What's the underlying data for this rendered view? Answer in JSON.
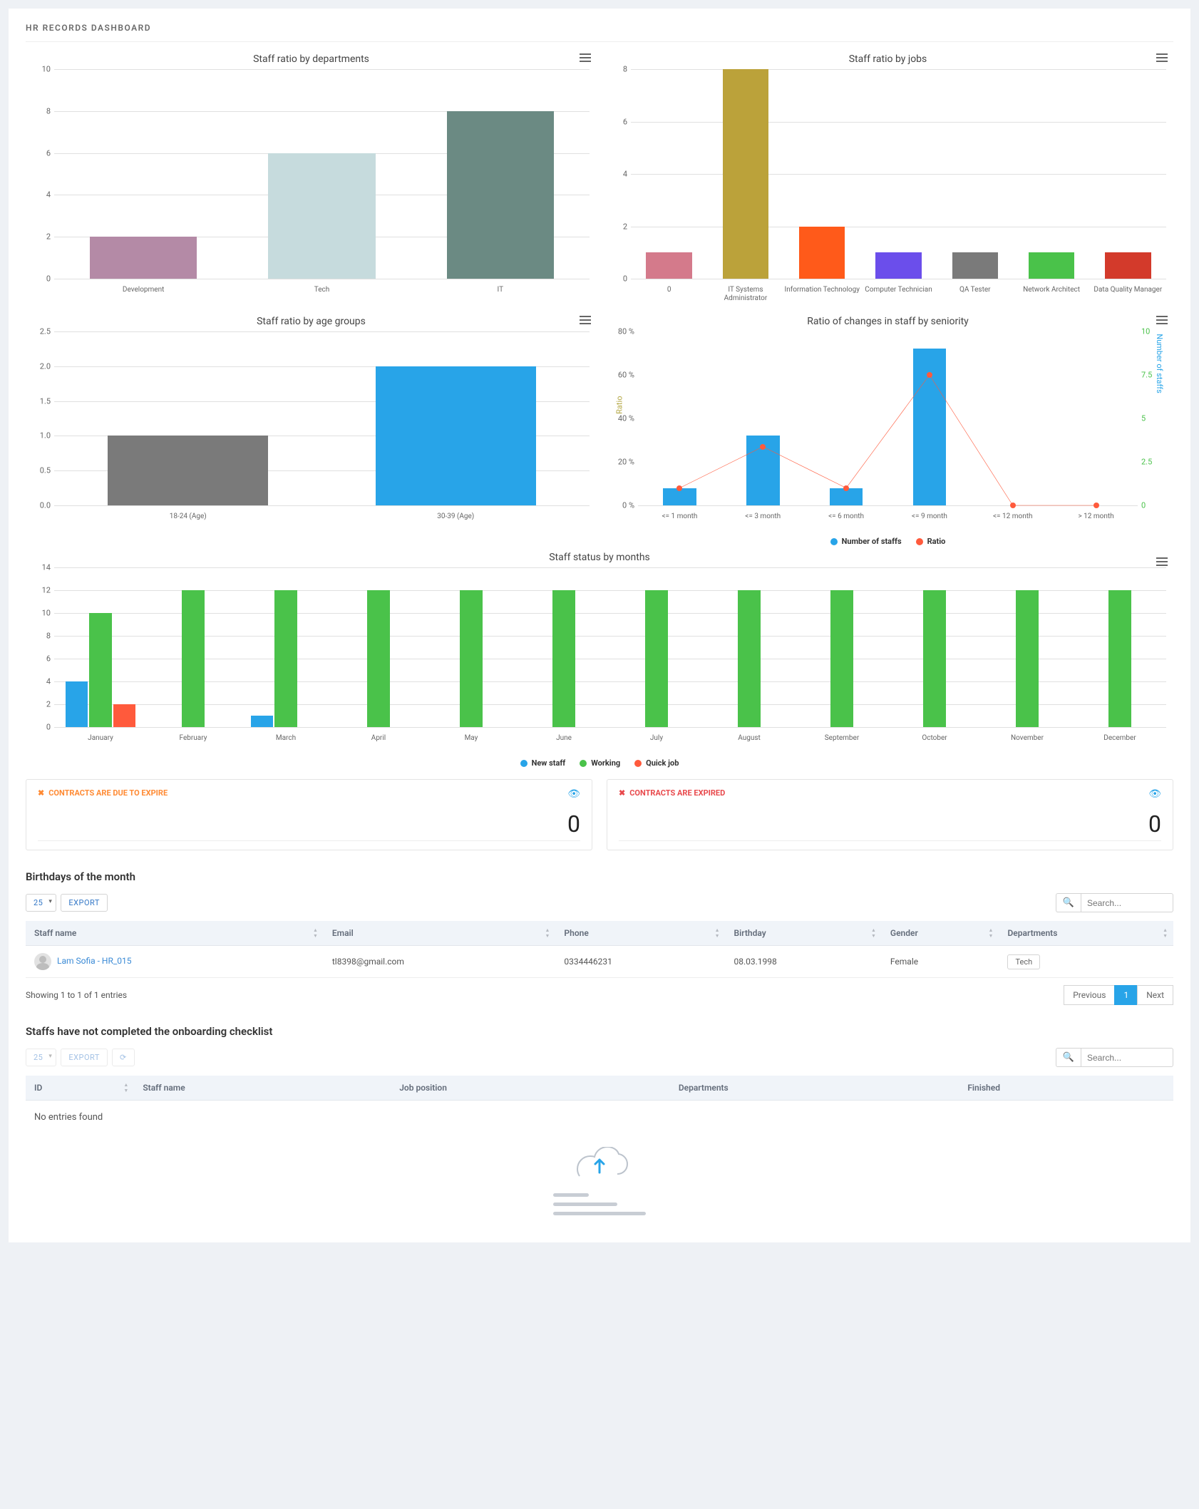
{
  "header": {
    "title": "HR RECORDS DASHBOARD"
  },
  "cards": {
    "due": {
      "title": "CONTRACTS ARE DUE TO EXPIRE",
      "value": "0"
    },
    "expired": {
      "title": "CONTRACTS ARE EXPIRED",
      "value": "0"
    }
  },
  "birthdays": {
    "title": "Birthdays of the month",
    "page_size": "25",
    "export": "EXPORT",
    "search_placeholder": "Search...",
    "cols": {
      "staff": "Staff name",
      "email": "Email",
      "phone": "Phone",
      "birthday": "Birthday",
      "gender": "Gender",
      "dept": "Departments"
    },
    "row": {
      "name": "Lam Sofia - HR_015",
      "email": "tl8398@gmail.com",
      "phone": "0334446231",
      "birthday": "08.03.1998",
      "gender": "Female",
      "dept": "Tech"
    },
    "summary": "Showing 1 to 1 of 1 entries",
    "prev": "Previous",
    "page1": "1",
    "next": "Next"
  },
  "onboarding": {
    "title": "Staffs have not completed the onboarding checklist",
    "page_size": "25",
    "export": "EXPORT",
    "search_placeholder": "Search...",
    "cols": {
      "id": "ID",
      "staff": "Staff name",
      "job": "Job position",
      "dept": "Departments",
      "fin": "Finished"
    },
    "empty": "No entries found"
  },
  "chart_data": [
    {
      "id": "dept",
      "type": "bar",
      "title": "Staff ratio by departments",
      "categories": [
        "Development",
        "Tech",
        "IT"
      ],
      "values": [
        2,
        6,
        8
      ],
      "colors": [
        "#b48aa6",
        "#c6dbdd",
        "#6b8a83"
      ],
      "ylim": [
        0,
        10
      ],
      "ystep": 2
    },
    {
      "id": "jobs",
      "type": "bar",
      "title": "Staff ratio by jobs",
      "categories": [
        "0",
        "IT Systems Administrator",
        "Information Technology",
        "Computer Technician",
        "QA Tester",
        "Network Architect",
        "Data Quality Manager"
      ],
      "values": [
        1,
        8,
        2,
        1,
        1,
        1,
        1
      ],
      "colors": [
        "#d47a8b",
        "#bba23a",
        "#ff5a1a",
        "#6b4eeb",
        "#7a7a7a",
        "#4ac24a",
        "#d33a2b"
      ],
      "ylim": [
        0,
        8
      ],
      "ystep": 2
    },
    {
      "id": "age",
      "type": "bar",
      "title": "Staff ratio by age groups",
      "categories": [
        "18-24 (Age)",
        "30-39 (Age)"
      ],
      "values": [
        1,
        2
      ],
      "colors": [
        "#7a7a7a",
        "#28a4e8"
      ],
      "ylim": [
        0,
        2.5
      ],
      "ystep": 0.5
    },
    {
      "id": "seniority",
      "type": "bar+line",
      "title": "Ratio of changes in staff by seniority",
      "categories": [
        "<= 1 month",
        "<= 3 month",
        "<= 6 month",
        "<= 9 month",
        "<= 12 month",
        "> 12 month"
      ],
      "series": [
        {
          "name": "Number of staffs",
          "type": "bar",
          "values": [
            1,
            4,
            1,
            9,
            0,
            0
          ],
          "axis": "right",
          "color": "#28a4e8"
        },
        {
          "name": "Ratio",
          "type": "line",
          "values": [
            8,
            27,
            8,
            60,
            0,
            0
          ],
          "axis": "left",
          "color": "#ff5a3c"
        }
      ],
      "y_left": {
        "label": "Ratio",
        "lim": [
          0,
          80
        ],
        "step": 20,
        "suffix": " %"
      },
      "y_right": {
        "label": "Number of staffs",
        "lim": [
          0,
          10
        ],
        "step": 2.5
      }
    },
    {
      "id": "months",
      "type": "bar-grouped",
      "title": "Staff status by months",
      "categories": [
        "January",
        "February",
        "March",
        "April",
        "May",
        "June",
        "July",
        "August",
        "September",
        "October",
        "November",
        "December"
      ],
      "series": [
        {
          "name": "New staff",
          "color": "#28a4e8",
          "values": [
            4,
            0,
            1,
            0,
            0,
            0,
            0,
            0,
            0,
            0,
            0,
            0
          ]
        },
        {
          "name": "Working",
          "color": "#4ac24a",
          "values": [
            10,
            12,
            12,
            12,
            12,
            12,
            12,
            12,
            12,
            12,
            12,
            12
          ]
        },
        {
          "name": "Quick job",
          "color": "#ff5a3c",
          "values": [
            2,
            0,
            0,
            0,
            0,
            0,
            0,
            0,
            0,
            0,
            0,
            0
          ]
        }
      ],
      "ylim": [
        0,
        14
      ],
      "ystep": 2
    }
  ]
}
